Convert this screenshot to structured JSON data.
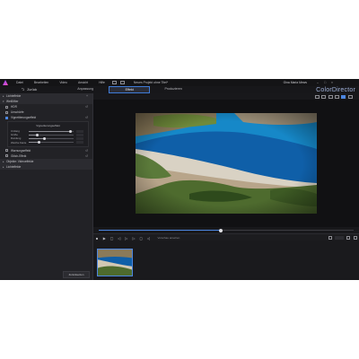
{
  "menubar": {
    "menus": [
      "Datei",
      "Bearbeiten",
      "Video",
      "Ansicht",
      "Hilfe"
    ],
    "project_title": "Neues Projekt ohne Titel*",
    "user_name": "Gina Maria Mews"
  },
  "header": {
    "back_label": "Zurück",
    "tabs": [
      {
        "label": "Anpassung",
        "active": false
      },
      {
        "label": "Effekt",
        "active": true
      },
      {
        "label": "Produzieren",
        "active": false
      }
    ],
    "brand": "ColorDirector"
  },
  "left_panel": {
    "sections": [
      {
        "label": "Lichteffekte",
        "expanded": false
      },
      {
        "label": "Weißfilter",
        "expanded": true
      }
    ],
    "items": [
      {
        "label": "HDR",
        "checked": false
      },
      {
        "label": "Unschärfe",
        "checked": false
      },
      {
        "label": "Vignettierungseffekt",
        "checked": true
      }
    ],
    "vignette": {
      "title": "Vignettierungseffekt",
      "sliders": [
        {
          "label": "Umfang",
          "value": 0.92
        },
        {
          "label": "Größe",
          "value": 0.18
        },
        {
          "label": "Rundung",
          "value": 0.34
        },
        {
          "label": "Weiche Kante",
          "value": 0.22
        }
      ]
    },
    "more_items": [
      {
        "label": "Warnungseffekt",
        "checked": false
      },
      {
        "label": "Glitch-Effekt",
        "checked": false
      }
    ],
    "more_sections": [
      {
        "label": "Objekte: Videoeffekte"
      },
      {
        "label": "Lichteffekte"
      }
    ],
    "footer_button": "Zurücksetzen"
  },
  "preview": {
    "seek_progress": 0.48,
    "apply_label": "Vorschau ansehen"
  },
  "colors": {
    "accent": "#4c86e0"
  }
}
